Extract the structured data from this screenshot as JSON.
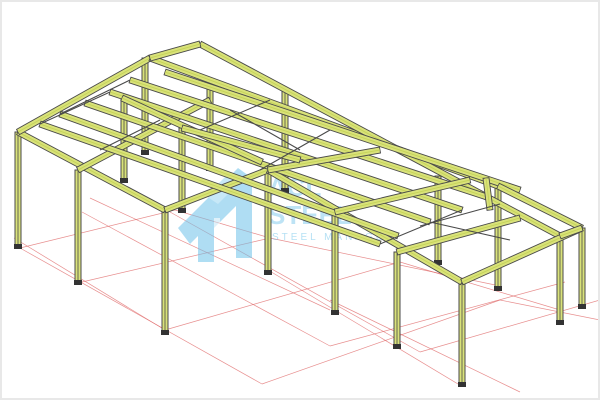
{
  "view": {
    "background": "#ffffff",
    "grid_color": "#e06a6a",
    "steel_color": "#4a4a4a",
    "beam_fill": "#d9e27a",
    "beam_highlight": "#c6d45a"
  },
  "watermark": {
    "brand_line1": "ACL",
    "brand_line2": "STEEL",
    "tagline": "STEEL MANAGER",
    "logo_icon": "building-a-icon",
    "color": "#6ec3ea"
  }
}
